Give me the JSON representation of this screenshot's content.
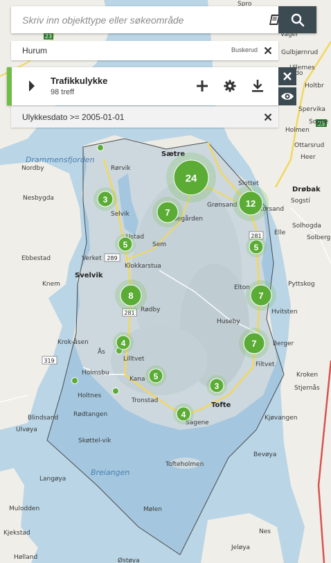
{
  "search": {
    "placeholder": "Skriv inn objekttype eller søkeområde",
    "value": ""
  },
  "icons": {
    "catalog": "book-icon",
    "search": "magnifier-icon",
    "close": "close-icon",
    "expand": "caret-right-icon",
    "add": "plus-icon",
    "settings": "gear-icon",
    "download": "download-icon",
    "visibility": "eye-icon"
  },
  "area_filter": {
    "name": "Hurum",
    "county": "Buskerud"
  },
  "layer": {
    "title": "Trafikkulykke",
    "count": "98 treff",
    "accent_color": "#6fbd44"
  },
  "attribute_filter": {
    "text": "Ulykkesdato >= 2005-01-01"
  },
  "map": {
    "water_names": [
      "Drammensfjorden",
      "Breiangen"
    ],
    "places": [
      "Spro",
      "Gulbjørnrud",
      "Nordby",
      "Rørvik",
      "Sætre",
      "Slottet",
      "Drøbak",
      "Sogstí",
      "Solhogda",
      "Solberg",
      "Nesbygda",
      "Selvik",
      "Grønsand",
      "Storsand",
      "Elle",
      "Ebbestad",
      "Verket",
      "Svelvik",
      "Klokkarstua",
      "Sem",
      "Knem",
      "Elton",
      "Hvitsten",
      "Pyttskog",
      "Rødby",
      "Huseby",
      "Krok-åsen",
      "Ås",
      "Lilltvet",
      "Filtvet",
      "Holmsbu",
      "Kana",
      "Tofte",
      "Holtnes",
      "Tronstad",
      "Kroken",
      "Stjernås",
      "Rødtangen",
      "Sagene",
      "Kjøvangen",
      "Blindsand",
      "Skøttel-vik",
      "Tofteholmen",
      "Ulvøya",
      "Langøya",
      "Bevøya",
      "Mulodden",
      "Kjekstad",
      "Mølen",
      "Nes",
      "Jeløya",
      "Hølland",
      "Østøya",
      "Ullernes",
      "Holtbr",
      "Spervika",
      "Holmen",
      "Ottarsrud",
      "Heer",
      "Ødegården",
      "Ustad",
      "Vager",
      "Ådo",
      "Sogne",
      "Berger"
    ],
    "road_numbers": [
      "23",
      "289",
      "281",
      "319",
      "281",
      "23"
    ]
  },
  "clusters": [
    {
      "count": "24",
      "label": "cluster-24"
    },
    {
      "count": "12",
      "label": "cluster-12"
    },
    {
      "count": "3",
      "label": "cluster-3-selvik"
    },
    {
      "count": "7",
      "label": "cluster-7-north"
    },
    {
      "count": "5",
      "label": "cluster-5-ustad"
    },
    {
      "count": "5",
      "label": "cluster-5-east"
    },
    {
      "count": "8",
      "label": "cluster-8"
    },
    {
      "count": "7",
      "label": "cluster-7-elton"
    },
    {
      "count": "4",
      "label": "cluster-4-as"
    },
    {
      "count": "7",
      "label": "cluster-7-filtvet"
    },
    {
      "count": "5",
      "label": "cluster-5-kana"
    },
    {
      "count": "3",
      "label": "cluster-3-tofte"
    },
    {
      "count": "4",
      "label": "cluster-4-sagene"
    }
  ]
}
